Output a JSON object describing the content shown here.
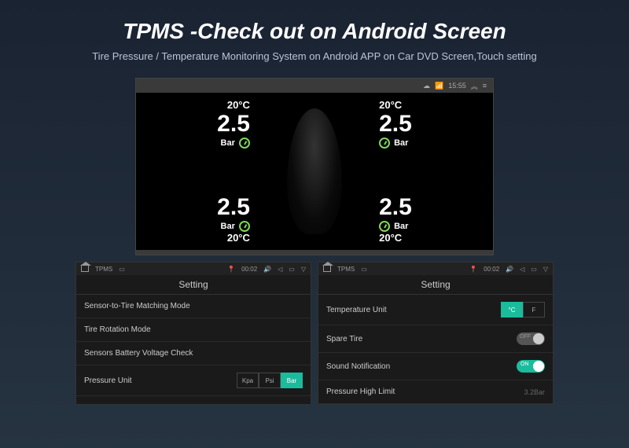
{
  "header": {
    "title": "TPMS -Check out on Android Screen",
    "subtitle": "Tire Pressure / Temperature Monitoring System on Android APP on Car DVD Screen,Touch setting"
  },
  "statusbar_top": {
    "time": "15:55"
  },
  "tires": {
    "fl": {
      "temp": "20°C",
      "pressure": "2.5",
      "unit": "Bar"
    },
    "fr": {
      "temp": "20°C",
      "pressure": "2.5",
      "unit": "Bar"
    },
    "rl": {
      "temp": "20°C",
      "pressure": "2.5",
      "unit": "Bar"
    },
    "rr": {
      "temp": "20°C",
      "pressure": "2.5",
      "unit": "Bar"
    }
  },
  "panel_status": {
    "app": "TPMS",
    "time": "00:02"
  },
  "left_panel": {
    "title": "Setting",
    "rows": {
      "sensor_match": "Sensor-to-Tire Matching Mode",
      "rotation": "Tire Rotation Mode",
      "battery": "Sensors Battery Voltage Check",
      "pressure_unit": "Pressure Unit"
    },
    "pressure_units": {
      "kpa": "Kpa",
      "psi": "Psi",
      "bar": "Bar"
    }
  },
  "right_panel": {
    "title": "Setting",
    "rows": {
      "temp_unit": "Temperature Unit",
      "spare": "Spare Tire",
      "sound": "Sound Notification",
      "high_limit": "Pressure High Limit"
    },
    "temp_units": {
      "c": "°C",
      "f": "F"
    },
    "high_limit_val": "3.2Bar"
  }
}
